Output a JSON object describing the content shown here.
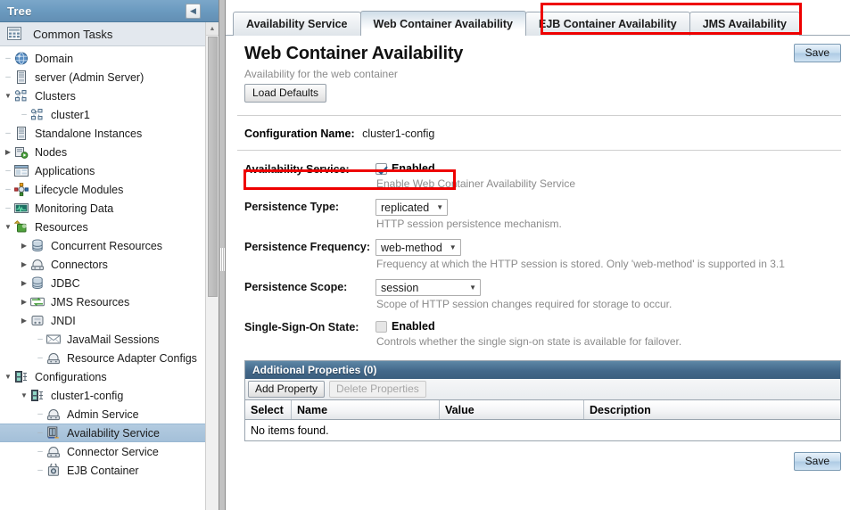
{
  "tree_panel": {
    "header_title": "Tree",
    "collapse_icon": "chevron-left-icon",
    "common_tasks": {
      "label": "Common Tasks",
      "icon": "common-tasks-icon"
    },
    "items": [
      {
        "label": "Domain",
        "icon": "domain-globe-icon",
        "depth": 1,
        "twisty": "",
        "selected": false
      },
      {
        "label": "server (Admin Server)",
        "icon": "server-icon",
        "depth": 1,
        "twisty": "",
        "selected": false
      },
      {
        "label": "Clusters",
        "icon": "cluster-icon",
        "depth": 1,
        "twisty": "▼",
        "selected": false
      },
      {
        "label": "cluster1",
        "icon": "cluster-icon",
        "depth": 2,
        "twisty": "",
        "selected": false
      },
      {
        "label": "Standalone Instances",
        "icon": "server-icon",
        "depth": 1,
        "twisty": "",
        "selected": false
      },
      {
        "label": "Nodes",
        "icon": "nodes-icon",
        "depth": 1,
        "twisty": "▶",
        "selected": false
      },
      {
        "label": "Applications",
        "icon": "applications-icon",
        "depth": 1,
        "twisty": "",
        "selected": false
      },
      {
        "label": "Lifecycle Modules",
        "icon": "lifecycle-modules-icon",
        "depth": 1,
        "twisty": "",
        "selected": false
      },
      {
        "label": "Monitoring Data",
        "icon": "monitoring-data-icon",
        "depth": 1,
        "twisty": "",
        "selected": false
      },
      {
        "label": "Resources",
        "icon": "resources-icon",
        "depth": 1,
        "twisty": "▼",
        "selected": false
      },
      {
        "label": "Concurrent Resources",
        "icon": "database-icon",
        "depth": 2,
        "twisty": "▶",
        "selected": false
      },
      {
        "label": "Connectors",
        "icon": "connector-icon",
        "depth": 2,
        "twisty": "▶",
        "selected": false
      },
      {
        "label": "JDBC",
        "icon": "database-icon",
        "depth": 2,
        "twisty": "▶",
        "selected": false
      },
      {
        "label": "JMS Resources",
        "icon": "jms-icon",
        "depth": 2,
        "twisty": "▶",
        "selected": false
      },
      {
        "label": "JNDI",
        "icon": "jndi-icon",
        "depth": 2,
        "twisty": "▶",
        "selected": false
      },
      {
        "label": "JavaMail Sessions",
        "icon": "mail-icon",
        "depth": 3,
        "twisty": "",
        "selected": false
      },
      {
        "label": "Resource Adapter Configs",
        "icon": "connector-icon",
        "depth": 3,
        "twisty": "",
        "selected": false
      },
      {
        "label": "Configurations",
        "icon": "configuration-icon",
        "depth": 1,
        "twisty": "▼",
        "selected": false
      },
      {
        "label": "cluster1-config",
        "icon": "configuration-icon",
        "depth": 2,
        "twisty": "▼",
        "selected": false
      },
      {
        "label": "Admin Service",
        "icon": "connector-icon",
        "depth": 3,
        "twisty": "",
        "selected": false
      },
      {
        "label": "Availability Service",
        "icon": "availability-icon",
        "depth": 3,
        "twisty": "",
        "selected": true
      },
      {
        "label": "Connector Service",
        "icon": "connector-icon",
        "depth": 3,
        "twisty": "",
        "selected": false
      },
      {
        "label": "EJB Container",
        "icon": "ejb-container-icon",
        "depth": 3,
        "twisty": "",
        "selected": false
      }
    ]
  },
  "tabs": [
    {
      "label": "Availability Service",
      "active": false
    },
    {
      "label": "Web Container Availability",
      "active": true
    },
    {
      "label": "EJB Container Availability",
      "active": false
    },
    {
      "label": "JMS Availability",
      "active": false
    }
  ],
  "page": {
    "title": "Web Container Availability",
    "subtitle": "Availability for the web container",
    "load_defaults_label": "Load Defaults",
    "save_label_top": "Save",
    "save_label_bottom": "Save",
    "configuration_name_label": "Configuration Name:",
    "configuration_name_value": "cluster1-config"
  },
  "form": {
    "availability_service": {
      "label": "Availability Service:",
      "checkbox_label": "Enabled",
      "checked": true,
      "help": "Enable Web Container Availability Service"
    },
    "persistence_type": {
      "label": "Persistence Type:",
      "value": "replicated",
      "help": "HTTP session persistence mechanism."
    },
    "persistence_frequency": {
      "label": "Persistence Frequency:",
      "value": "web-method",
      "help": "Frequency at which the HTTP session is stored. Only 'web-method' is supported in 3.1"
    },
    "persistence_scope": {
      "label": "Persistence Scope:",
      "value": "session",
      "help": "Scope of HTTP session changes required for storage to occur."
    },
    "single_sign_on_state": {
      "label": "Single-Sign-On State:",
      "checkbox_label": "Enabled",
      "checked": false,
      "help": "Controls whether the single sign-on state is available for failover."
    }
  },
  "additional_properties": {
    "header": "Additional Properties (0)",
    "add_label": "Add Property",
    "delete_label": "Delete Properties",
    "delete_disabled": true,
    "columns": [
      "Select",
      "Name",
      "Value",
      "Description"
    ],
    "rows": [],
    "empty_text": "No items found."
  },
  "annotations": {
    "tabs_highlight_color": "#ee0000",
    "availability_highlight_color": "#ee0000"
  }
}
